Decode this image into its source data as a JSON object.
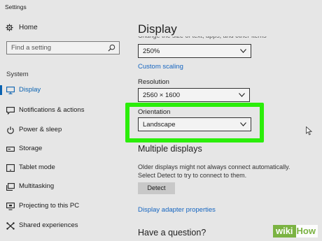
{
  "window": {
    "title": "Settings"
  },
  "sidebar": {
    "home_label": "Home",
    "search_placeholder": "Find a setting",
    "section_label": "System",
    "items": [
      {
        "label": "Display",
        "icon": "monitor-icon",
        "active": true
      },
      {
        "label": "Notifications & actions",
        "icon": "message-icon"
      },
      {
        "label": "Power & sleep",
        "icon": "power-icon"
      },
      {
        "label": "Storage",
        "icon": "storage-icon"
      },
      {
        "label": "Tablet mode",
        "icon": "tablet-icon"
      },
      {
        "label": "Multitasking",
        "icon": "multitasking-icon"
      },
      {
        "label": "Projecting to this PC",
        "icon": "projector-icon"
      },
      {
        "label": "Shared experiences",
        "icon": "shared-icon"
      }
    ]
  },
  "main": {
    "title": "Display",
    "cut_text": "Change the size of text, apps, and other items",
    "scale": {
      "value": "250%"
    },
    "custom_scaling_link": "Custom scaling",
    "resolution": {
      "label": "Resolution",
      "value": "2560 × 1600"
    },
    "orientation": {
      "label": "Orientation",
      "value": "Landscape"
    },
    "multiple_displays": {
      "heading": "Multiple displays",
      "description": "Older displays might not always connect automatically. Select Detect to try to connect to them.",
      "detect_button": "Detect",
      "adapter_link": "Display adapter properties"
    },
    "question_heading": "Have a question?"
  },
  "watermark": {
    "wiki": "wiki",
    "how": "How"
  },
  "colors": {
    "accent": "#0a62b0",
    "highlight": "#2bee0a",
    "link": "#1565c0",
    "background": "#e6e6e6"
  }
}
